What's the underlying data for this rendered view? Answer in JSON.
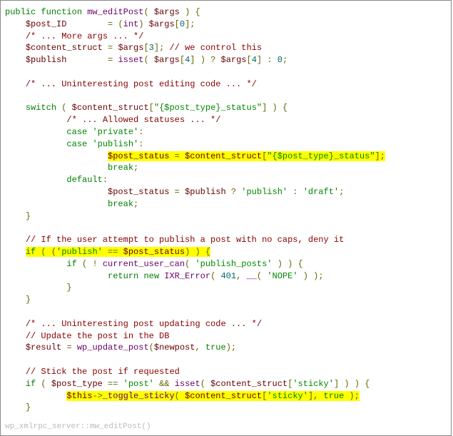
{
  "code": {
    "l1": {
      "kw1": "public",
      "kw2": "function",
      "fn": "mw_editPost",
      "op1": "(",
      "var": "$args",
      "op2": ")",
      "op3": "{"
    },
    "l2": {
      "var1": "$post_ID",
      "op1": "=",
      "op2": "(",
      "cast": "int",
      "op3": ")",
      "var2": "$args",
      "op4": "[",
      "num": "0",
      "op5": "];"
    },
    "l3": {
      "cmt": "/* ... More args ... */"
    },
    "l4": {
      "var1": "$content_struct",
      "op1": "=",
      "var2": "$args",
      "op2": "[",
      "num": "3",
      "op3": "];",
      "cmt": "// we control this"
    },
    "l5": {
      "var1": "$publish",
      "op1": "=",
      "fn": "isset",
      "op2": "(",
      "var2": "$args",
      "op3": "[",
      "num1": "4",
      "op4": "]",
      "op5": ")",
      "op6": "?",
      "var3": "$args",
      "op7": "[",
      "num2": "4",
      "op8": "]",
      "op9": ":",
      "num3": "0",
      "op10": ";"
    },
    "l7": {
      "cmt": "/* ... Uninteresting post editing code ... */"
    },
    "l9": {
      "kw": "switch",
      "op1": "(",
      "var": "$content_struct",
      "op2": "[",
      "str": "\"{$post_type}_status\"",
      "op3": "]",
      "op4": ")",
      "op5": "{"
    },
    "l10": {
      "cmt": "/* ... Allowed statuses ... */"
    },
    "l11": {
      "kw": "case",
      "str": "'private'",
      "op": ":"
    },
    "l12": {
      "kw": "case",
      "str": "'publish'",
      "op": ":"
    },
    "l13": {
      "var1": "$post_status",
      "op1": "=",
      "var2": "$content_struct",
      "op2": "[",
      "str": "\"{$post_type}_status\"",
      "op3": "];"
    },
    "l14": {
      "kw": "break",
      "op": ";"
    },
    "l15": {
      "kw": "default",
      "op": ":"
    },
    "l16": {
      "var1": "$post_status",
      "op1": "=",
      "var2": "$publish",
      "op2": "?",
      "str1": "'publish'",
      "op3": ":",
      "str2": "'draft'",
      "op4": ";"
    },
    "l17": {
      "kw": "break",
      "op": ";"
    },
    "l18": {
      "op": "}"
    },
    "l20": {
      "cmt": "// If the user attempt to publish a post with no caps, deny it"
    },
    "l21": {
      "kw": "if",
      "op1": "(",
      "op2": "(",
      "str": "'publish'",
      "op3": "==",
      "var": "$post_status",
      "op4": ")",
      "op5": ")",
      "op6": "{"
    },
    "l22": {
      "kw": "if",
      "op1": "(",
      "op2": "!",
      "fn": "current_user_can",
      "op3": "(",
      "str": "'publish_posts'",
      "op4": ")",
      "op5": ")",
      "op6": "{"
    },
    "l23": {
      "kw": "return",
      "kw2": "new",
      "fn": "IXR_Error",
      "op1": "(",
      "num": "401",
      "op2": ",",
      "fn2": "__",
      "op3": "(",
      "str": "'NOPE'",
      "op4": ")",
      "op5": ");"
    },
    "l24": {
      "op": "}"
    },
    "l25": {
      "op": "}"
    },
    "l27": {
      "cmt": "/* ... Uninteresting post updating code ... */"
    },
    "l28": {
      "cmt": "// Update the post in the DB"
    },
    "l29": {
      "var1": "$result",
      "op1": "=",
      "fn": "wp_update_post",
      "op2": "(",
      "var2": "$newpost",
      "op3": ",",
      "bool": "true",
      "op4": ");"
    },
    "l31": {
      "cmt": "// Stick the post if requested"
    },
    "l32": {
      "kw": "if",
      "op1": "(",
      "var1": "$post_type",
      "op2": "==",
      "str1": "'post'",
      "op3": "&&",
      "fn": "isset",
      "op4": "(",
      "var2": "$content_struct",
      "op5": "[",
      "str2": "'sticky'",
      "op6": "]",
      "op7": ")",
      "op8": ")",
      "op9": "{"
    },
    "l33": {
      "var1": "$this",
      "op1": "->",
      "fn": "_toggle_sticky",
      "op2": "(",
      "var2": "$content_struct",
      "op3": "[",
      "str": "'sticky'",
      "op4": "],",
      "bool": "true",
      "op5": ");"
    },
    "l34": {
      "op": "}"
    }
  },
  "footer": "wp_xmlrpc_server::mw_editPost()"
}
